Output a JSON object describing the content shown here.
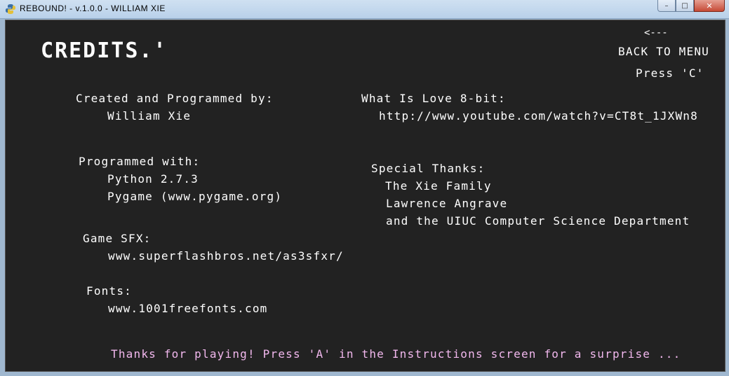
{
  "window": {
    "title": "REBOUND!  -  v.1.0.0  -  WILLIAM XIE",
    "icon": "python-icon",
    "controls": {
      "minimize": "–",
      "maximize": "□",
      "close": "✕"
    }
  },
  "credits": {
    "title": "CREDITS.'",
    "back": {
      "arrow": "<---",
      "label": "BACK TO MENU",
      "hint": "Press 'C'"
    },
    "created_by": {
      "heading": "Created and Programmed by:",
      "name": "William Xie"
    },
    "programmed_with": {
      "heading": "Programmed with:",
      "items": [
        "Python 2.7.3",
        "Pygame (www.pygame.org)"
      ]
    },
    "game_sfx": {
      "heading": "Game SFX:",
      "value": "www.superflashbros.net/as3sfxr/"
    },
    "fonts": {
      "heading": "Fonts:",
      "value": "www.1001freefonts.com"
    },
    "music": {
      "heading": "What Is Love 8-bit:",
      "value": "http://www.youtube.com/watch?v=CT8t_1JXWn8"
    },
    "special_thanks": {
      "heading": "Special Thanks:",
      "items": [
        "The Xie Family",
        "Lawrence Angrave",
        "and the UIUC Computer Science Department"
      ]
    },
    "footer": "Thanks for playing! Press 'A' in the Instructions screen for a surprise ..."
  },
  "colors": {
    "background": "#222222",
    "text": "#ffffff",
    "footer": "#f2b8ee"
  }
}
